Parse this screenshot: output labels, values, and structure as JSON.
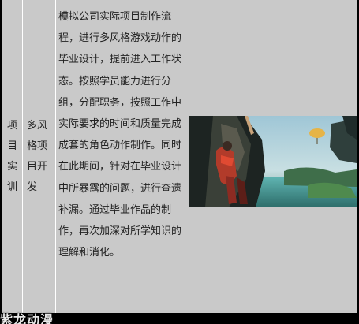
{
  "table": {
    "row": {
      "category": "项\n目\n实\n训",
      "project": "多风\n格项\n目开\n发",
      "description": "模拟公司实际项目制作流程，进行多风格游戏动作的毕业设计，提前进入工作状态。按照学员能力进行分组，分配职务，按照工作中实际要求的时间和质量完成成套的角色动作制作。同时在此期间，针对在毕业设计中所暴露的问题，进行查遗补漏。通过毕业作品的制作，再次加深对所学知识的理解和消化。",
      "image": "game-artwork-climbing-character"
    }
  },
  "watermark": "紫龙动漫",
  "colors": {
    "table_bg": "#c9c9c9",
    "border": "#ffffff",
    "page_bg": "#000000",
    "text": "#222222"
  }
}
